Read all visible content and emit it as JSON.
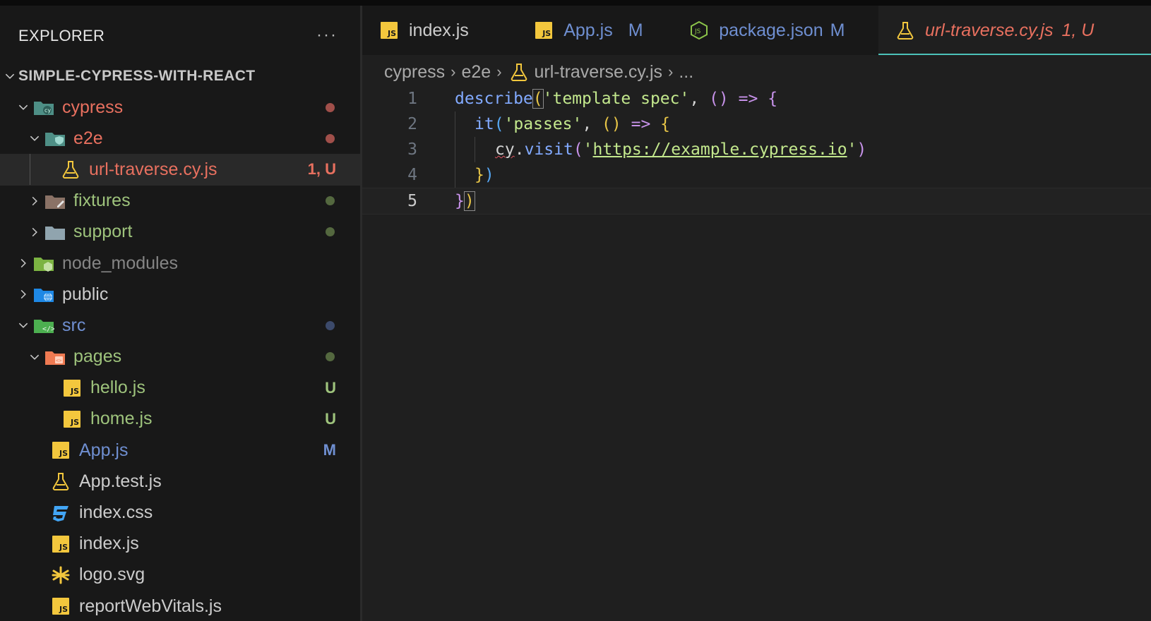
{
  "sidebar": {
    "title": "EXPLORER",
    "more_label": "···",
    "project": "SIMPLE-CYPRESS-WITH-REACT",
    "items": [
      {
        "label": "cypress",
        "status": "",
        "color": "#e8705f",
        "dot": "#a04f4a"
      },
      {
        "label": "e2e",
        "status": "",
        "color": "#e8705f",
        "dot": "#a04f4a"
      },
      {
        "label": "url-traverse.cy.js",
        "status": "1, U",
        "color": "#e8705f",
        "badge_color": "#e8705f"
      },
      {
        "label": "fixtures",
        "status": "",
        "color": "#9ec37c",
        "dot": "#54683f"
      },
      {
        "label": "support",
        "status": "",
        "color": "#9ec37c",
        "dot": "#54683f"
      },
      {
        "label": "node_modules",
        "status": "",
        "color": "#858585"
      },
      {
        "label": "public",
        "status": "",
        "color": "#cccccc"
      },
      {
        "label": "src",
        "status": "",
        "color": "#6f8fd1",
        "dot": "#3c4a6b"
      },
      {
        "label": "pages",
        "status": "",
        "color": "#9ec37c",
        "dot": "#54683f"
      },
      {
        "label": "hello.js",
        "status": "U",
        "color": "#9ec37c",
        "badge_color": "#9ec37c"
      },
      {
        "label": "home.js",
        "status": "U",
        "color": "#9ec37c",
        "badge_color": "#9ec37c"
      },
      {
        "label": "App.js",
        "status": "M",
        "color": "#6f8fd1",
        "badge_color": "#6f8fd1"
      },
      {
        "label": "App.test.js",
        "status": "",
        "color": "#cccccc"
      },
      {
        "label": "index.css",
        "status": "",
        "color": "#cccccc"
      },
      {
        "label": "index.js",
        "status": "",
        "color": "#cccccc"
      },
      {
        "label": "logo.svg",
        "status": "",
        "color": "#cccccc"
      },
      {
        "label": "reportWebVitals.js",
        "status": "",
        "color": "#cccccc"
      }
    ]
  },
  "tabs": [
    {
      "label": "index.js",
      "status": "",
      "icon": "js-icon",
      "color": "#cccccc"
    },
    {
      "label": "App.js",
      "status": "M",
      "icon": "js-icon",
      "color": "#6f8fd1"
    },
    {
      "label": "package.json",
      "status": "M",
      "icon": "nodejs-icon",
      "color": "#6f8fd1"
    },
    {
      "label": "url-traverse.cy.js",
      "status": "1, U",
      "icon": "flask-icon",
      "color": "#e8705f"
    }
  ],
  "breadcrumb": {
    "parts": [
      "cypress",
      "e2e",
      "url-traverse.cy.js",
      "..."
    ]
  },
  "editor": {
    "line_numbers": [
      "1",
      "2",
      "3",
      "4",
      "5"
    ],
    "current_line": 5,
    "code": {
      "l1_fn": "describe",
      "l1_str": "'template spec'",
      "l2_fn": "it",
      "l2_str": "'passes'",
      "l3_var": "cy",
      "l3_fn": "visit",
      "l3_q1": "'",
      "l3_url": "https://example.cypress.io",
      "l3_q2": "'"
    }
  }
}
